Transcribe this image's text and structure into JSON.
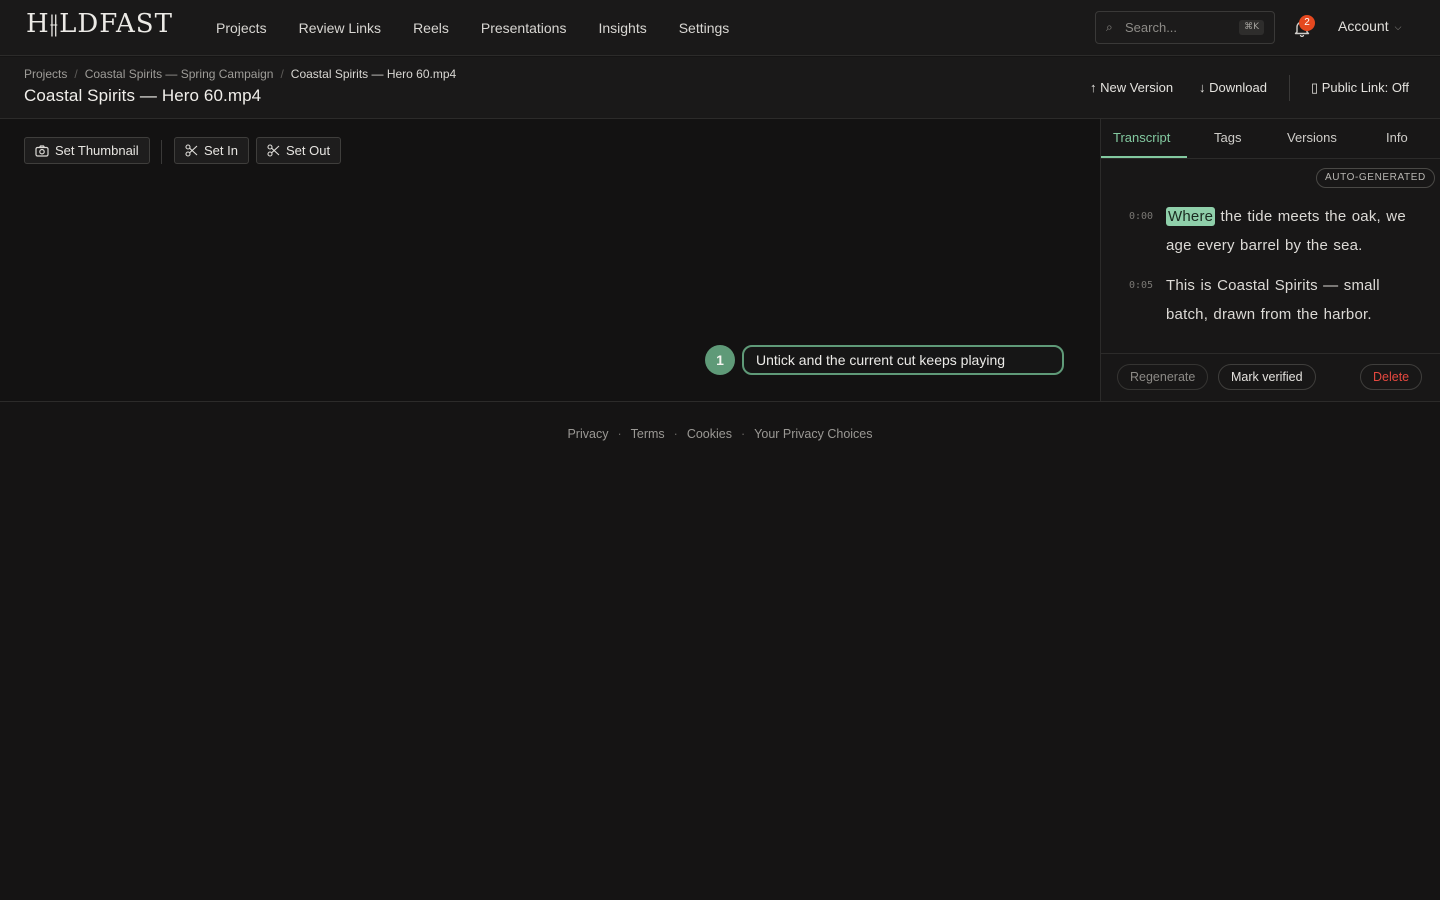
{
  "app": {
    "logo": "H⫲LDFAST"
  },
  "nav": {
    "links": [
      "Projects",
      "Review Links",
      "Reels",
      "Presentations",
      "Insights",
      "Settings"
    ],
    "search_placeholder": "Search...",
    "search_shortcut": "⌘K",
    "notifications_count": "2",
    "account_label": "Account"
  },
  "breadcrumb": [
    "Projects",
    "Coastal Spirits — Spring Campaign",
    "Coastal Spirits — Hero 60.mp4"
  ],
  "page_title": "Coastal Spirits — Hero 60.mp4",
  "header_actions": {
    "new_version": "↑ New Version",
    "download": "↓ Download",
    "public_link": "▯ Public Link: Off"
  },
  "toolbar": {
    "set_thumbnail": "Set Thumbnail",
    "set_in": "Set In",
    "set_out": "Set Out"
  },
  "step": {
    "number": "1",
    "text": "Untick and the current cut keeps playing"
  },
  "panel": {
    "tabs": [
      "Transcript",
      "Tags",
      "Versions",
      "Info"
    ],
    "active_tab": "Transcript",
    "badge": "AUTO-GENERATED",
    "transcript": [
      {
        "time": "0:00",
        "highlight": "Where",
        "text": " the tide meets the oak, we age every barrel by the sea."
      },
      {
        "time": "0:05",
        "highlight": "",
        "text": "This is Coastal Spirits — small batch, drawn from the harbor."
      }
    ],
    "buttons": {
      "regenerate": "Regenerate",
      "mark_verified": "Mark verified",
      "delete": "Delete"
    }
  },
  "footer": [
    "Privacy",
    "Terms",
    "Cookies",
    "Your Privacy Choices"
  ],
  "colors": {
    "accent": "#83c9a0",
    "step": "#5f9a78",
    "danger": "#e5483f",
    "badge": "#e5481f"
  }
}
